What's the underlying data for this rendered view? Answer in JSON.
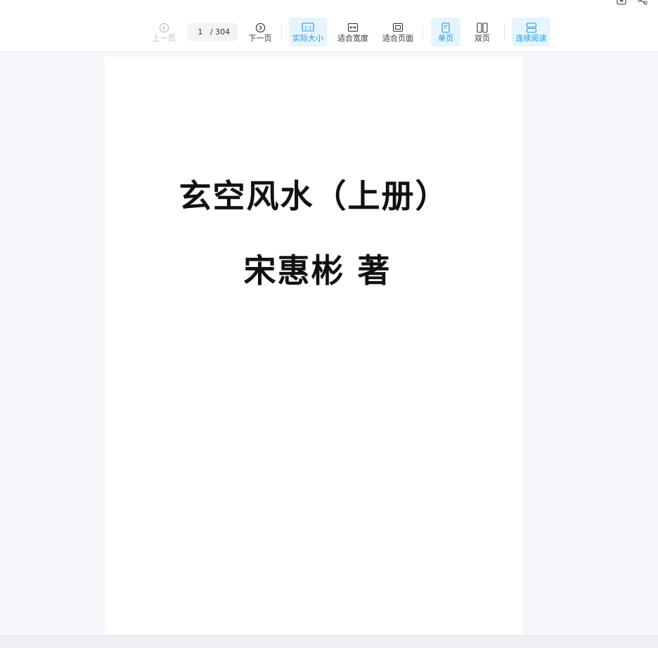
{
  "toolbar": {
    "prev_page": "上一页",
    "current_page": "1",
    "total_pages": "/ 304",
    "next_page": "下一页",
    "actual_size": "实际大小",
    "fit_width": "适合宽度",
    "fit_page": "适合页面",
    "single_page": "单页",
    "double_page": "双页",
    "continuous": "连续阅读",
    "actual_size_icon_text": "1:1"
  },
  "document": {
    "title": "玄空风水（上册）",
    "author": "宋惠彬 著"
  },
  "colors": {
    "accent": "#1a9be0",
    "active_bg": "#e6f4fd",
    "disabled": "#b8bcc4",
    "viewer_bg": "#f5f7fa"
  },
  "icons": {
    "top_right": [
      "download-icon",
      "share-icon"
    ],
    "prev": "chevron-left-circle-icon",
    "next": "chevron-right-circle-icon",
    "actual_size": "one-to-one-icon",
    "fit_width": "fit-width-icon",
    "fit_page": "fit-page-icon",
    "single": "single-page-icon",
    "double": "double-page-icon",
    "continuous": "continuous-scroll-icon"
  }
}
